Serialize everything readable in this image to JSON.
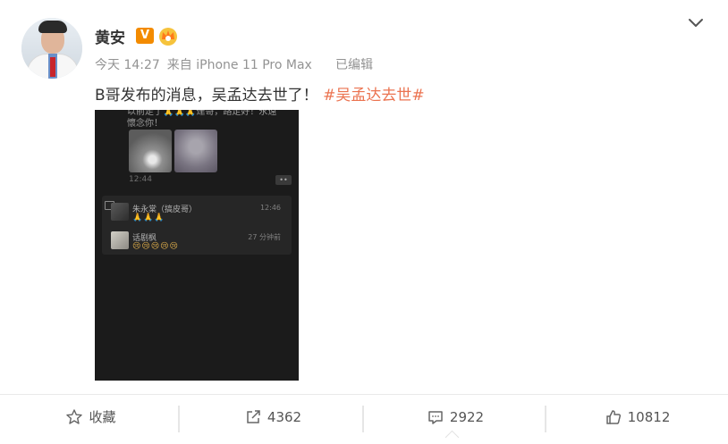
{
  "post": {
    "author": {
      "name": "黄安",
      "verified_icon": "orange-v-badge",
      "vip_icon": "crown-icon",
      "verified_letter": "V"
    },
    "meta": {
      "time": "今天 14:27",
      "source": "来自 iPhone 11 Pro Max",
      "edited": "已编辑"
    },
    "content": {
      "text": "B哥发布的消息，吴孟达去世了！",
      "hashtag": "#吴孟达去世#"
    },
    "image": {
      "top_text_line1": "以前走了🙏🙏🙏達哥，路走好！永遠",
      "top_text_line2": "懷念你！",
      "time1": "12:44",
      "more_label": "••",
      "comments": [
        {
          "name": "朱永棠（搞皮哥）",
          "emoji": "🙏🙏🙏",
          "time": "12:46"
        },
        {
          "name": "话剧枫",
          "emoji": "😢😢😢😢😢",
          "time": "27 分钟前"
        }
      ]
    }
  },
  "actions": {
    "favorite": {
      "label": "收藏",
      "icon": "star-outline-icon"
    },
    "repost": {
      "label": "4362",
      "icon": "share-icon"
    },
    "comment": {
      "label": "2922",
      "icon": "comment-icon"
    },
    "like": {
      "label": "10812",
      "icon": "thumbs-up-icon"
    }
  },
  "colors": {
    "hashtag": "#eb7350",
    "meta": "#939393",
    "badge": "#f38b00"
  }
}
